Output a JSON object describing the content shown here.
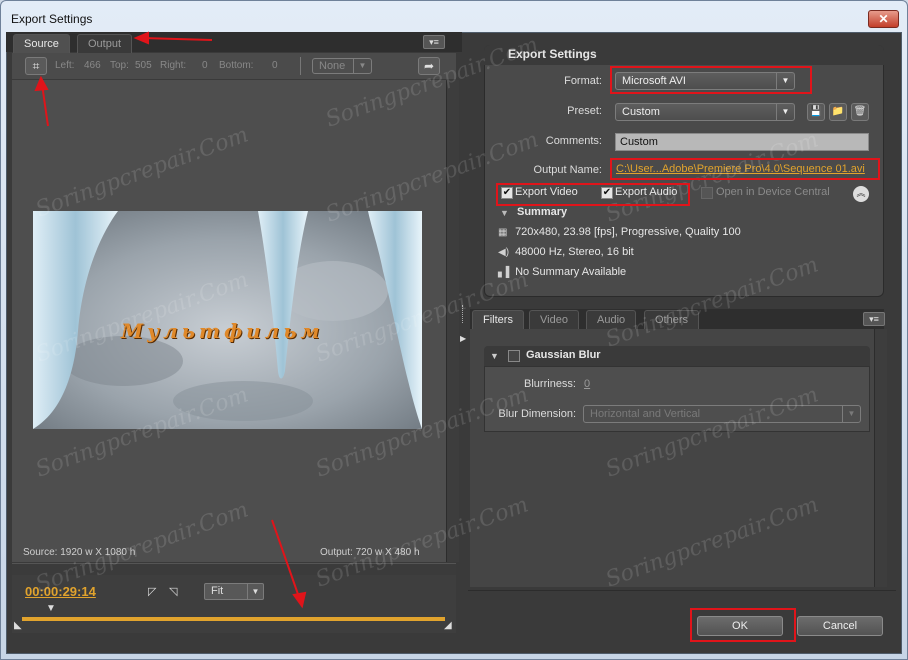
{
  "window": {
    "title": "Export Settings",
    "close_glyph": "✕"
  },
  "left_panel": {
    "tabs": [
      {
        "label": "Source",
        "active": true
      },
      {
        "label": "Output",
        "active": false
      }
    ],
    "crop": {
      "left_label": "Left:",
      "left_value": "466",
      "top_label": "Top:",
      "top_value": "505",
      "right_label": "Right:",
      "right_value": "0",
      "bottom_label": "Bottom:",
      "bottom_value": "0",
      "ratio_select": "None"
    },
    "preview_caption": "Мультфильм",
    "source_info": "Source: 1920 w X 1080 h",
    "output_info": "Output: 720 w X 480 h",
    "timecode": "00:00:29:14",
    "zoom_select": "Fit"
  },
  "export_settings": {
    "header": "Export Settings",
    "format_label": "Format:",
    "format_value": "Microsoft AVI",
    "preset_label": "Preset:",
    "preset_value": "Custom",
    "comments_label": "Comments:",
    "comments_value": "Custom",
    "output_name_label": "Output Name:",
    "output_name_value": "C:\\User...Adobe\\Premiere Pro\\4.0\\Sequence 01.avi",
    "export_video_label": "Export Video",
    "export_video_checked": true,
    "export_audio_label": "Export Audio",
    "export_audio_checked": true,
    "device_central_label": "Open in Device Central",
    "summary_header": "Summary",
    "summary": {
      "video": "720x480, 23.98 [fps], Progressive, Quality 100",
      "audio": "48000 Hz, Stereo, 16 bit",
      "other": "No Summary Available"
    }
  },
  "filters_panel": {
    "tabs": [
      {
        "label": "Filters",
        "active": true
      },
      {
        "label": "Video",
        "active": false
      },
      {
        "label": "Audio",
        "active": false
      },
      {
        "label": "Others",
        "active": false
      }
    ],
    "filter_name": "Gaussian Blur",
    "blurriness_label": "Blurriness:",
    "blurriness_value": "0",
    "blur_dimension_label": "Blur Dimension:",
    "blur_dimension_value": "Horizontal and Vertical"
  },
  "buttons": {
    "ok": "OK",
    "cancel": "Cancel"
  },
  "watermark": "Soringpcrepair.Com",
  "colors": {
    "accent_orange": "#e1a32d",
    "highlight_red": "#e0141a",
    "panel_dark": "#3a3a3a"
  }
}
